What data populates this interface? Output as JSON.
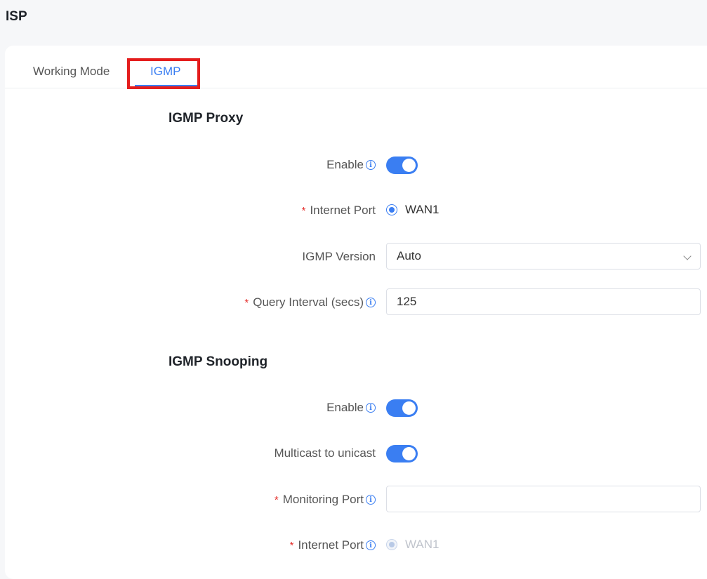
{
  "page": {
    "title": "ISP"
  },
  "tabs": [
    {
      "label": "Working Mode"
    },
    {
      "label": "IGMP"
    }
  ],
  "igmp_proxy": {
    "title": "IGMP Proxy",
    "enable_label": "Enable",
    "enable_on": true,
    "internet_port_label": "Internet Port",
    "internet_port_value": "WAN1",
    "version_label": "IGMP Version",
    "version_value": "Auto",
    "query_interval_label": "Query Interval (secs)",
    "query_interval_value": "125"
  },
  "igmp_snooping": {
    "title": "IGMP Snooping",
    "enable_label": "Enable",
    "enable_on": true,
    "multicast_label": "Multicast to unicast",
    "multicast_on": true,
    "monitoring_port_label": "Monitoring Port",
    "monitoring_port_value": "",
    "internet_port_label": "Internet Port",
    "internet_port_value": "WAN1"
  },
  "symbols": {
    "required": "*",
    "info": "i"
  },
  "colors": {
    "accent": "#3a7ef2",
    "highlight": "#e41d1d",
    "required": "#e5302d"
  }
}
